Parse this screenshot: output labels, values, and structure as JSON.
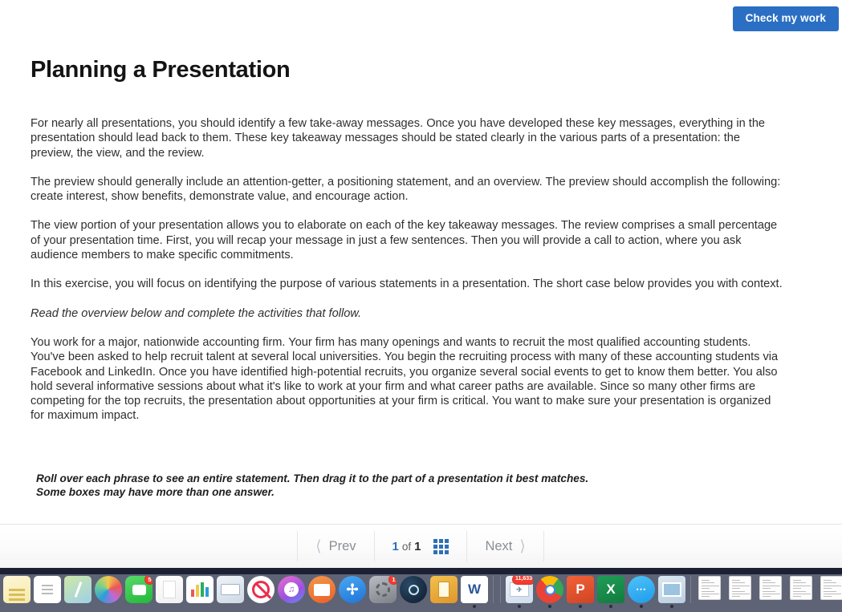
{
  "toolbar": {
    "check_label": "Check my work"
  },
  "page": {
    "title": "Planning a Presentation",
    "paragraphs": [
      "For nearly all presentations, you should identify a few take-away messages. Once you have developed these key messages, everything in the presentation should lead back to them. These key takeaway messages should be stated clearly in the various parts of a presentation: the preview, the view, and the review.",
      "The preview should generally include an attention-getter, a positioning statement, and an overview. The preview should accomplish the following: create interest, show benefits, demonstrate value, and encourage action.",
      "The view portion of your presentation allows you to elaborate on each of the key takeaway messages. The review comprises a small percentage of your presentation time. First, you will recap your message in just a few sentences. Then you will provide a call to action, where you ask audience members to make specific commitments.",
      "In this exercise, you will focus on identifying the purpose of various statements in a presentation. The short case below provides you with context."
    ],
    "italic_instruction": "Read the overview below and complete the activities that follow.",
    "case_paragraph": "You work for a major, nationwide accounting firm. Your firm has many openings and wants to recruit the most qualified accounting students. You've been asked to help recruit talent at several local universities. You begin the recruiting process with many of these accounting students via Facebook and LinkedIn. Once you have identified high-potential recruits, you organize several social events to get to know them better. You also hold several informative sessions about what it's like to work at your firm and what career paths are available. Since so many other firms are competing for the top recruits, the presentation about opportunities at your firm is critical. You want to make sure your presentation is organized for maximum impact.",
    "drag_instruction_line1": "Roll over each phrase to see an entire statement. Then drag it to the part of a presentation it best matches.",
    "drag_instruction_line2": "Some boxes may have more than one answer."
  },
  "pager": {
    "prev_label": "Prev",
    "next_label": "Next",
    "current_page": "1",
    "of_label": "of",
    "total_pages": "1",
    "grid_icon": "grid-view-icon"
  },
  "colors": {
    "accent_blue": "#2a6fc4",
    "pager_blue": "#2f6fb5",
    "dock_bg": "#5e6375",
    "badge_red": "#f53b2f"
  },
  "dock": {
    "items": [
      {
        "name": "notes",
        "badge": "",
        "running": false
      },
      {
        "name": "reminders",
        "badge": "",
        "running": false
      },
      {
        "name": "maps",
        "badge": "",
        "running": false
      },
      {
        "name": "photos",
        "badge": "",
        "running": false
      },
      {
        "name": "facetime",
        "badge": "5",
        "running": false
      },
      {
        "name": "pages",
        "badge": "",
        "running": false
      },
      {
        "name": "numbers",
        "badge": "",
        "running": false
      },
      {
        "name": "keynote",
        "badge": "",
        "running": false
      },
      {
        "name": "news",
        "badge": "",
        "running": false
      },
      {
        "name": "itunes",
        "badge": "",
        "running": false
      },
      {
        "name": "ibooks",
        "badge": "",
        "running": false
      },
      {
        "name": "app-store",
        "badge": "",
        "running": false
      },
      {
        "name": "system-preferences",
        "badge": "1",
        "running": false
      },
      {
        "name": "steam",
        "badge": "",
        "running": false
      },
      {
        "name": "stuffit-expander",
        "badge": "",
        "running": false
      },
      {
        "name": "microsoft-word",
        "badge": "",
        "running": true
      },
      {
        "name": "mail",
        "badge": "11,633",
        "running": true
      },
      {
        "name": "google-chrome",
        "badge": "",
        "running": true
      },
      {
        "name": "microsoft-powerpoint",
        "badge": "",
        "running": true
      },
      {
        "name": "microsoft-excel",
        "badge": "",
        "running": true
      },
      {
        "name": "messages",
        "badge": "",
        "running": true
      },
      {
        "name": "preview",
        "badge": "",
        "running": true
      }
    ],
    "minimized_windows": [
      {
        "name": "minimized-window-document"
      },
      {
        "name": "minimized-window-finder"
      },
      {
        "name": "minimized-window-mail"
      },
      {
        "name": "minimized-window-spreadsheet"
      },
      {
        "name": "minimized-window-other"
      }
    ]
  }
}
